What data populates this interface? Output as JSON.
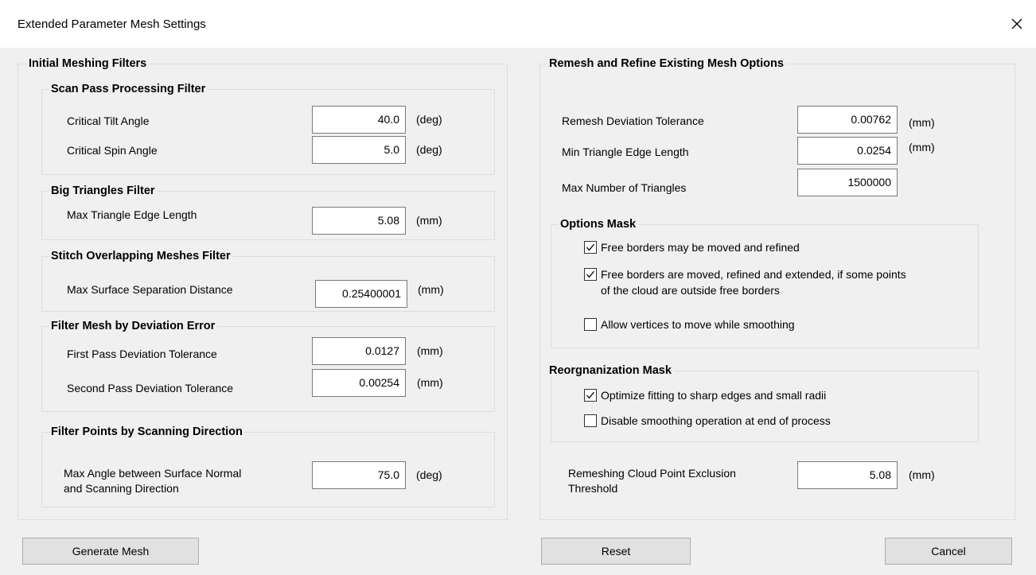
{
  "window": {
    "title": "Extended Parameter Mesh Settings"
  },
  "left": {
    "title": "Initial Meshing Filters",
    "scan_pass": {
      "title": "Scan Pass Processing Filter",
      "tilt": {
        "label": "Critical Tilt Angle",
        "value": "40.0",
        "unit": "(deg)"
      },
      "spin": {
        "label": "Critical Spin Angle",
        "value": "5.0",
        "unit": "(deg)"
      }
    },
    "big_triangles": {
      "title": "Big Triangles Filter",
      "edge": {
        "label": "Max Triangle Edge Length",
        "value": "5.08",
        "unit": "(mm)"
      }
    },
    "stitch": {
      "title": "Stitch Overlapping Meshes Filter",
      "separation": {
        "label": "Max Surface Separation Distance",
        "value": "0.25400001",
        "unit": "(mm)"
      }
    },
    "deviation": {
      "title": "Filter Mesh by Deviation Error",
      "first": {
        "label": "First Pass Deviation Tolerance",
        "value": "0.0127",
        "unit": "(mm)"
      },
      "second": {
        "label": "Second Pass Deviation Tolerance",
        "value": "0.00254",
        "unit": "(mm)"
      }
    },
    "scan_dir": {
      "title": "Filter Points by Scanning Direction",
      "angle": {
        "label_line1": "Max Angle between Surface Normal",
        "label_line2": "and Scanning Direction",
        "value": "75.0",
        "unit": "(deg)"
      }
    }
  },
  "right": {
    "title": "Remesh and Refine Existing Mesh Options",
    "remesh_tol": {
      "label": "Remesh Deviation Tolerance",
      "value": "0.00762",
      "unit": "(mm)"
    },
    "min_edge": {
      "label": "Min Triangle Edge Length",
      "value": "0.0254",
      "unit": "(mm)"
    },
    "max_tri": {
      "label": "Max Number of Triangles",
      "value": "1500000"
    },
    "options_mask": {
      "title": "Options Mask",
      "opt1": {
        "label": "Free borders may be moved and refined",
        "checked": true
      },
      "opt2": {
        "label_line1": "Free borders are moved, refined and extended, if some points",
        "label_line2": "of the cloud are outside free borders",
        "checked": true
      },
      "opt3": {
        "label": "Allow vertices to move while smoothing",
        "checked": false
      }
    },
    "reorg_mask": {
      "title": "Reorgnanization Mask",
      "opt1": {
        "label": "Optimize fitting to sharp edges and small radii",
        "checked": true
      },
      "opt2": {
        "label": "Disable smoothing operation at end of process",
        "checked": false
      }
    },
    "exclusion": {
      "label_line1": "Remeshing Cloud Point Exclusion",
      "label_line2": "Threshold",
      "value": "5.08",
      "unit": "(mm)"
    }
  },
  "buttons": {
    "generate": "Generate Mesh",
    "reset": "Reset",
    "cancel": "Cancel"
  }
}
